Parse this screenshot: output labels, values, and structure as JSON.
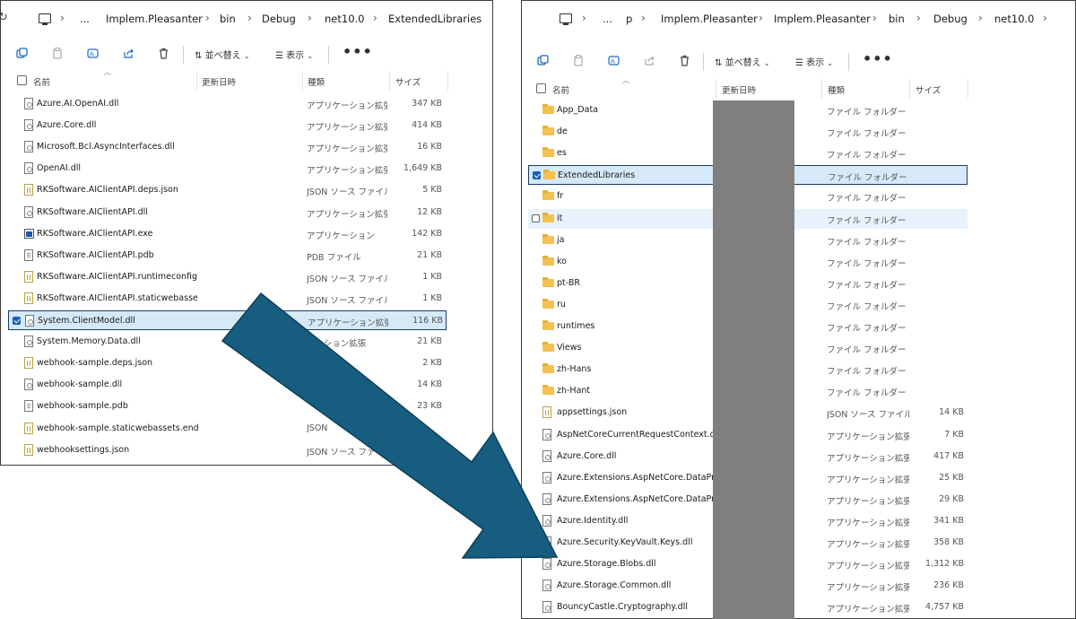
{
  "left_window": {
    "breadcrumb": [
      "...",
      "Implem.Pleasanter",
      "bin",
      "Debug",
      "net10.0",
      "ExtendedLibraries"
    ],
    "toolbar": {
      "sort_label": "並べ替え",
      "view_label": "表示",
      "more_label": "•••"
    },
    "columns": {
      "name": "名前",
      "modified": "更新日時",
      "type": "種類",
      "size": "サイズ"
    },
    "rows": [
      {
        "name": "Azure.AI.OpenAI.dll",
        "type": "アプリケーション拡張",
        "size": "347 KB",
        "icon": "dll"
      },
      {
        "name": "Azure.Core.dll",
        "type": "アプリケーション拡張",
        "size": "414 KB",
        "icon": "dll"
      },
      {
        "name": "Microsoft.Bcl.AsyncInterfaces.dll",
        "type": "アプリケーション拡張",
        "size": "16 KB",
        "icon": "dll"
      },
      {
        "name": "OpenAI.dll",
        "type": "アプリケーション拡張",
        "size": "1,649 KB",
        "icon": "dll"
      },
      {
        "name": "RKSoftware.AIClientAPI.deps.json",
        "type": "JSON ソース ファイル",
        "size": "5 KB",
        "icon": "json"
      },
      {
        "name": "RKSoftware.AIClientAPI.dll",
        "type": "アプリケーション拡張",
        "size": "12 KB",
        "icon": "dll"
      },
      {
        "name": "RKSoftware.AIClientAPI.exe",
        "type": "アプリケーション",
        "size": "142 KB",
        "icon": "exe"
      },
      {
        "name": "RKSoftware.AIClientAPI.pdb",
        "type": "PDB ファイル",
        "size": "21 KB",
        "icon": "pdb"
      },
      {
        "name": "RKSoftware.AIClientAPI.runtimeconfig....",
        "type": "JSON ソース ファイル",
        "size": "1 KB",
        "icon": "json"
      },
      {
        "name": "RKSoftware.AIClientAPI.staticwebasset...",
        "type": "JSON ソース ファイル",
        "size": "1 KB",
        "icon": "json"
      },
      {
        "name": "System.ClientModel.dll",
        "type": "アプリケーション拡張",
        "size": "116 KB",
        "icon": "dll",
        "selected": true
      },
      {
        "name": "System.Memory.Data.dll",
        "type": "ケーション拡張",
        "size": "21 KB",
        "icon": "dll"
      },
      {
        "name": "webhook-sample.deps.json",
        "type": "ファイル",
        "size": "2 KB",
        "icon": "json"
      },
      {
        "name": "webhook-sample.dll",
        "type": "",
        "size": "14 KB",
        "icon": "dll"
      },
      {
        "name": "webhook-sample.pdb",
        "type": "",
        "size": "23 KB",
        "icon": "pdb"
      },
      {
        "name": "webhook-sample.staticwebassets.end...",
        "type": "JSON",
        "size": "",
        "icon": "json"
      },
      {
        "name": "webhooksettings.json",
        "type": "JSON ソース ファイル",
        "size": "",
        "icon": "json"
      }
    ]
  },
  "right_window": {
    "breadcrumb": [
      "...",
      "p",
      "Implem.Pleasanter",
      "Implem.Pleasanter",
      "bin",
      "Debug",
      "net10.0"
    ],
    "toolbar": {
      "sort_label": "並べ替え",
      "view_label": "表示",
      "more_label": "•••"
    },
    "columns": {
      "name": "名前",
      "modified": "更新日時",
      "type": "種類",
      "size": "サイズ"
    },
    "rows": [
      {
        "name": "App_Data",
        "type": "ファイル フォルダー",
        "size": "",
        "icon": "folder"
      },
      {
        "name": "de",
        "type": "ファイル フォルダー",
        "size": "",
        "icon": "folder"
      },
      {
        "name": "es",
        "type": "ファイル フォルダー",
        "size": "",
        "icon": "folder"
      },
      {
        "name": "ExtendedLibraries",
        "type": "ファイル フォルダー",
        "size": "",
        "icon": "folder",
        "selected": true
      },
      {
        "name": "fr",
        "type": "ファイル フォルダー",
        "size": "",
        "icon": "folder"
      },
      {
        "name": "it",
        "type": "ファイル フォルダー",
        "size": "",
        "icon": "folder",
        "hover": true
      },
      {
        "name": "ja",
        "type": "ファイル フォルダー",
        "size": "",
        "icon": "folder"
      },
      {
        "name": "ko",
        "type": "ファイル フォルダー",
        "size": "",
        "icon": "folder"
      },
      {
        "name": "pt-BR",
        "type": "ファイル フォルダー",
        "size": "",
        "icon": "folder"
      },
      {
        "name": "ru",
        "type": "ファイル フォルダー",
        "size": "",
        "icon": "folder"
      },
      {
        "name": "runtimes",
        "type": "ファイル フォルダー",
        "size": "",
        "icon": "folder"
      },
      {
        "name": "Views",
        "type": "ファイル フォルダー",
        "size": "",
        "icon": "folder"
      },
      {
        "name": "zh-Hans",
        "type": "ファイル フォルダー",
        "size": "",
        "icon": "folder"
      },
      {
        "name": "zh-Hant",
        "type": "ファイル フォルダー",
        "size": "",
        "icon": "folder"
      },
      {
        "name": "appsettings.json",
        "type": "JSON ソース ファイル",
        "size": "14 KB",
        "icon": "json"
      },
      {
        "name": "AspNetCoreCurrentRequestContext.dll",
        "type": "アプリケーション拡張",
        "size": "7 KB",
        "icon": "dll"
      },
      {
        "name": "Azure.Core.dll",
        "type": "アプリケーション拡張",
        "size": "417 KB",
        "icon": "dll"
      },
      {
        "name": "Azure.Extensions.AspNetCore.DataPro...",
        "type": "アプリケーション拡張",
        "size": "25 KB",
        "icon": "dll"
      },
      {
        "name": "Azure.Extensions.AspNetCore.DataPro...",
        "type": "アプリケーション拡張",
        "size": "29 KB",
        "icon": "dll"
      },
      {
        "name": "Azure.Identity.dll",
        "type": "アプリケーション拡張",
        "size": "341 KB",
        "icon": "dll"
      },
      {
        "name": "Azure.Security.KeyVault.Keys.dll",
        "type": "アプリケーション拡張",
        "size": "358 KB",
        "icon": "dll"
      },
      {
        "name": "Azure.Storage.Blobs.dll",
        "type": "アプリケーション拡張",
        "size": "1,312 KB",
        "icon": "dll"
      },
      {
        "name": "Azure.Storage.Common.dll",
        "type": "アプリケーション拡張",
        "size": "236 KB",
        "icon": "dll"
      },
      {
        "name": "BouncyCastle.Cryptography.dll",
        "type": "アプリケーション拡張",
        "size": "4,757 KB",
        "icon": "dll"
      }
    ]
  },
  "icons": {
    "refresh": "refresh-icon",
    "pc": "computer-icon",
    "new": "new-window-icon",
    "copy": "copy-icon",
    "rename": "rename-icon",
    "share": "share-icon",
    "delete": "trash-icon",
    "sort": "sort-icon",
    "view": "view-icon"
  },
  "colors": {
    "arrow": "#165d80",
    "selection": "#d6e9f8",
    "hover": "#e8f2fc",
    "redaction": "#7f7f7f",
    "checkbox": "#1a5fb4"
  }
}
